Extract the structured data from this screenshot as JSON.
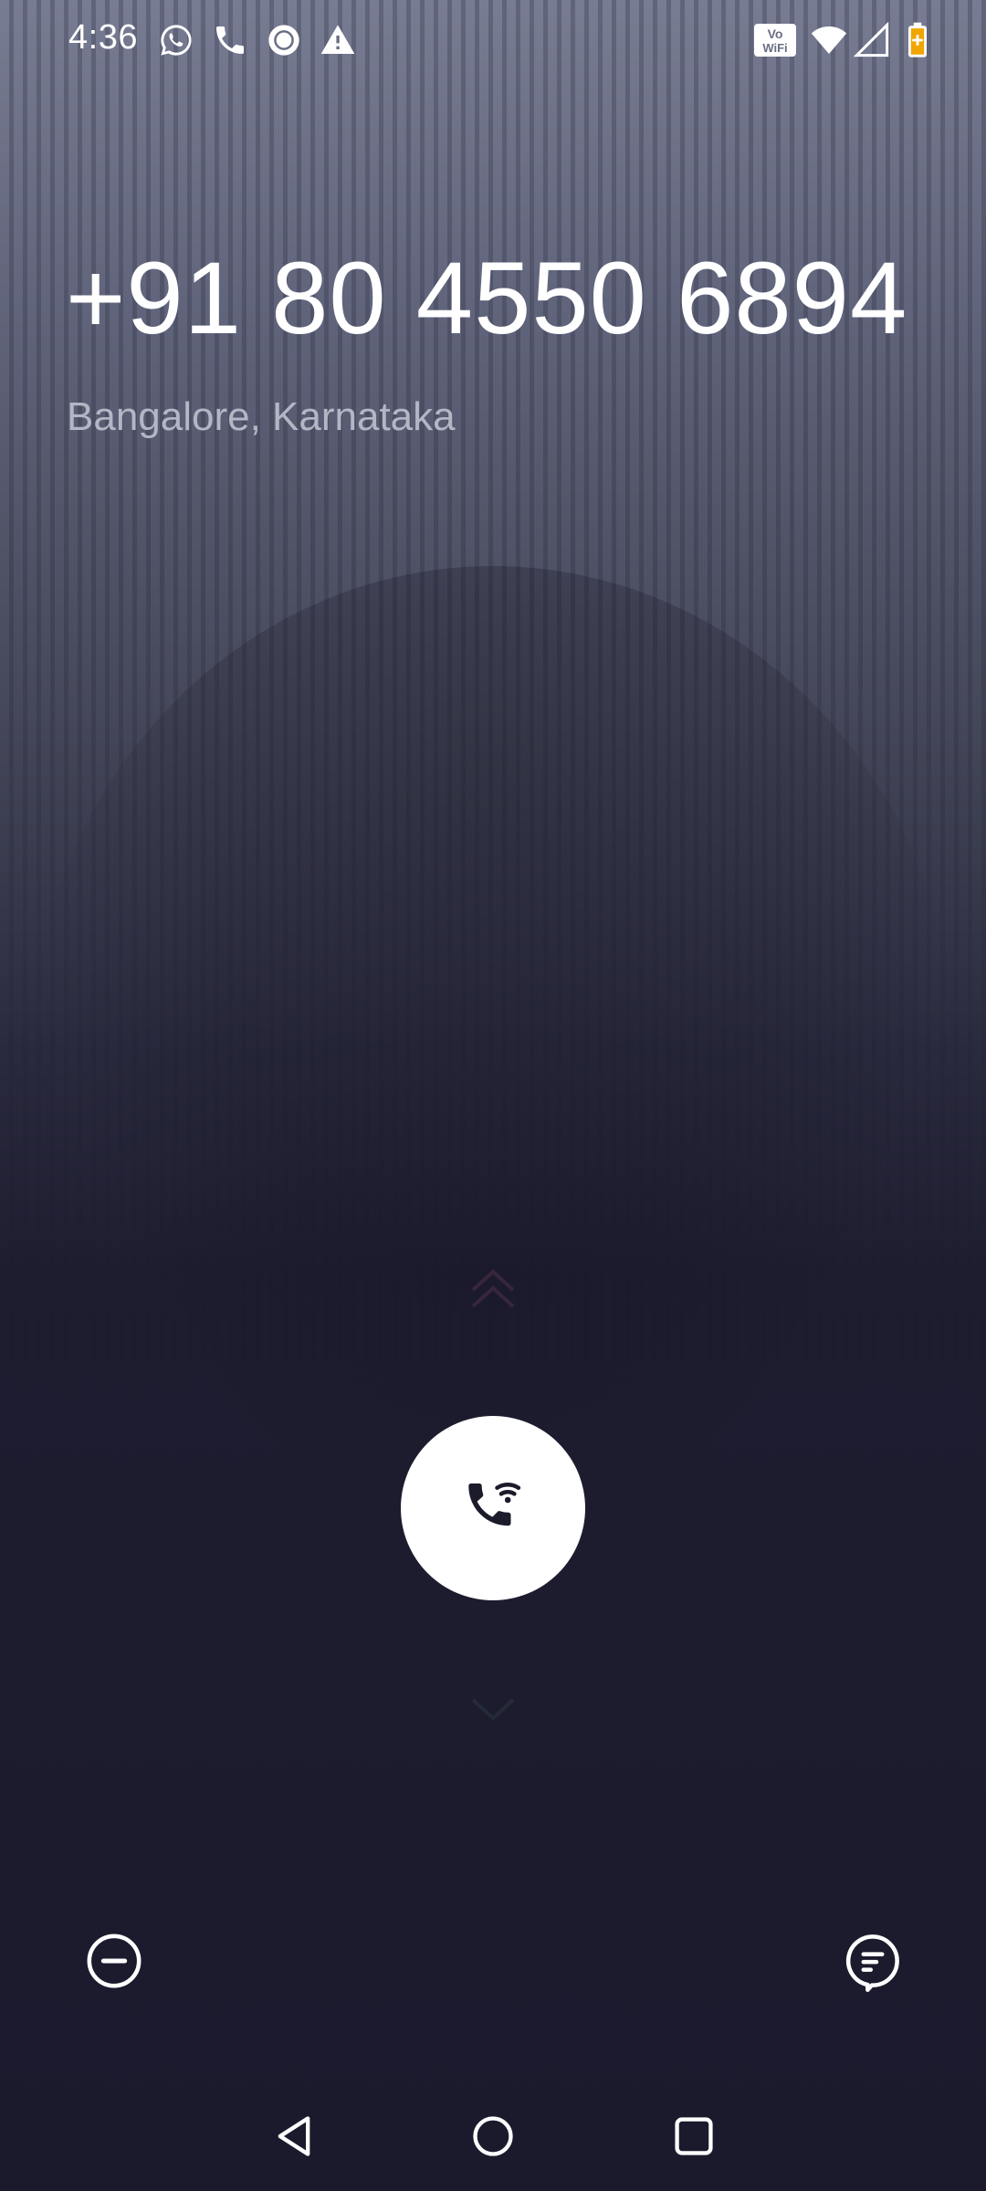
{
  "status_bar": {
    "time": "4:36",
    "notification_icons": [
      "whatsapp-icon",
      "phone-icon",
      "ring-app-icon",
      "warning-icon"
    ],
    "system_icons": [
      "vowifi-icon",
      "wifi-icon",
      "cell-signal-icon",
      "battery-icon"
    ],
    "vowifi_top": "Vo",
    "vowifi_bottom": "WiFi"
  },
  "call": {
    "number": "+91 80 4550 6894",
    "location": "Bangalore, Karnataka"
  },
  "actions": {
    "answer_icon": "wifi-call-icon",
    "decline_message_icon": "do-not-disturb-icon",
    "reply_message_icon": "message-icon"
  },
  "nav": {
    "back_icon": "back-triangle-icon",
    "home_icon": "home-circle-icon",
    "recents_icon": "recents-square-icon"
  },
  "colors": {
    "background_top": "#777c93",
    "background_bottom": "#1b1a2d",
    "text_primary": "#ffffff",
    "text_secondary": "#b3b6c4",
    "battery_accent": "#f0a500"
  }
}
